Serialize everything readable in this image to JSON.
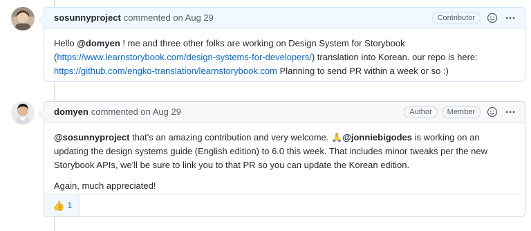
{
  "comments": [
    {
      "author": "sosunnyproject",
      "meta": "commented on Aug 29",
      "badges": [
        "Contributor"
      ],
      "body": {
        "p1_greeting": "Hello ",
        "p1_mention": "@domyen",
        "p1_text1": " ! me and three other folks are working on Design System for Storybook (",
        "p1_link1": "https://www.learnstorybook.com/design-systems-for-developers/",
        "p1_text2": ") translation into Korean. our repo is here: ",
        "p1_link2": "https://github.com/engko-translation/learnstorybook.com",
        "p1_text3": " Planning to send PR within a week or so :)"
      }
    },
    {
      "author": "domyen",
      "meta": "commented on Aug 29",
      "badges": [
        "Author",
        "Member"
      ],
      "body": {
        "p1_mention1": "@sosunnyproject",
        "p1_text1": " that's an amazing contribution and very welcome. ",
        "p1_emoji": "🙏",
        "p1_mention2": "@jonniebigodes",
        "p1_text2": " is working on an updating the design systems guide (English edition) to 6.0 this week. That includes minor tweaks per the new Storybook APIs, we'll be sure to link you to that PR so you can update the Korean edition.",
        "p2": "Again, much appreciated!"
      },
      "reactions": [
        {
          "emoji": "👍",
          "count": "1"
        }
      ]
    }
  ],
  "icons": {
    "emoji_picker": "smiley-icon",
    "more": "kebab-horizontal-icon"
  }
}
